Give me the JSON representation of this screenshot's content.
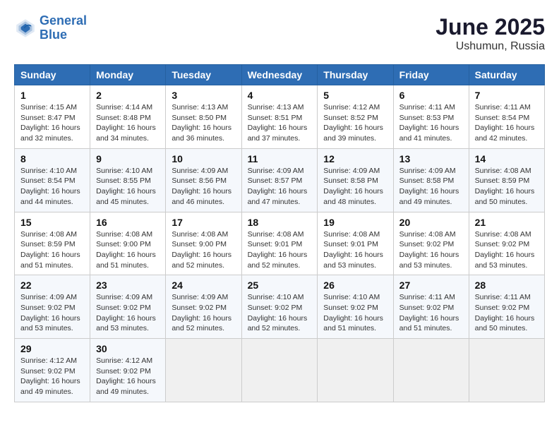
{
  "header": {
    "logo_line1": "General",
    "logo_line2": "Blue",
    "title": "June 2025",
    "subtitle": "Ushumun, Russia"
  },
  "calendar": {
    "headers": [
      "Sunday",
      "Monday",
      "Tuesday",
      "Wednesday",
      "Thursday",
      "Friday",
      "Saturday"
    ],
    "rows": [
      [
        {
          "day": "1",
          "lines": [
            "Sunrise: 4:15 AM",
            "Sunset: 8:47 PM",
            "Daylight: 16 hours",
            "and 32 minutes."
          ]
        },
        {
          "day": "2",
          "lines": [
            "Sunrise: 4:14 AM",
            "Sunset: 8:48 PM",
            "Daylight: 16 hours",
            "and 34 minutes."
          ]
        },
        {
          "day": "3",
          "lines": [
            "Sunrise: 4:13 AM",
            "Sunset: 8:50 PM",
            "Daylight: 16 hours",
            "and 36 minutes."
          ]
        },
        {
          "day": "4",
          "lines": [
            "Sunrise: 4:13 AM",
            "Sunset: 8:51 PM",
            "Daylight: 16 hours",
            "and 37 minutes."
          ]
        },
        {
          "day": "5",
          "lines": [
            "Sunrise: 4:12 AM",
            "Sunset: 8:52 PM",
            "Daylight: 16 hours",
            "and 39 minutes."
          ]
        },
        {
          "day": "6",
          "lines": [
            "Sunrise: 4:11 AM",
            "Sunset: 8:53 PM",
            "Daylight: 16 hours",
            "and 41 minutes."
          ]
        },
        {
          "day": "7",
          "lines": [
            "Sunrise: 4:11 AM",
            "Sunset: 8:54 PM",
            "Daylight: 16 hours",
            "and 42 minutes."
          ]
        }
      ],
      [
        {
          "day": "8",
          "lines": [
            "Sunrise: 4:10 AM",
            "Sunset: 8:54 PM",
            "Daylight: 16 hours",
            "and 44 minutes."
          ]
        },
        {
          "day": "9",
          "lines": [
            "Sunrise: 4:10 AM",
            "Sunset: 8:55 PM",
            "Daylight: 16 hours",
            "and 45 minutes."
          ]
        },
        {
          "day": "10",
          "lines": [
            "Sunrise: 4:09 AM",
            "Sunset: 8:56 PM",
            "Daylight: 16 hours",
            "and 46 minutes."
          ]
        },
        {
          "day": "11",
          "lines": [
            "Sunrise: 4:09 AM",
            "Sunset: 8:57 PM",
            "Daylight: 16 hours",
            "and 47 minutes."
          ]
        },
        {
          "day": "12",
          "lines": [
            "Sunrise: 4:09 AM",
            "Sunset: 8:58 PM",
            "Daylight: 16 hours",
            "and 48 minutes."
          ]
        },
        {
          "day": "13",
          "lines": [
            "Sunrise: 4:09 AM",
            "Sunset: 8:58 PM",
            "Daylight: 16 hours",
            "and 49 minutes."
          ]
        },
        {
          "day": "14",
          "lines": [
            "Sunrise: 4:08 AM",
            "Sunset: 8:59 PM",
            "Daylight: 16 hours",
            "and 50 minutes."
          ]
        }
      ],
      [
        {
          "day": "15",
          "lines": [
            "Sunrise: 4:08 AM",
            "Sunset: 8:59 PM",
            "Daylight: 16 hours",
            "and 51 minutes."
          ]
        },
        {
          "day": "16",
          "lines": [
            "Sunrise: 4:08 AM",
            "Sunset: 9:00 PM",
            "Daylight: 16 hours",
            "and 51 minutes."
          ]
        },
        {
          "day": "17",
          "lines": [
            "Sunrise: 4:08 AM",
            "Sunset: 9:00 PM",
            "Daylight: 16 hours",
            "and 52 minutes."
          ]
        },
        {
          "day": "18",
          "lines": [
            "Sunrise: 4:08 AM",
            "Sunset: 9:01 PM",
            "Daylight: 16 hours",
            "and 52 minutes."
          ]
        },
        {
          "day": "19",
          "lines": [
            "Sunrise: 4:08 AM",
            "Sunset: 9:01 PM",
            "Daylight: 16 hours",
            "and 53 minutes."
          ]
        },
        {
          "day": "20",
          "lines": [
            "Sunrise: 4:08 AM",
            "Sunset: 9:02 PM",
            "Daylight: 16 hours",
            "and 53 minutes."
          ]
        },
        {
          "day": "21",
          "lines": [
            "Sunrise: 4:08 AM",
            "Sunset: 9:02 PM",
            "Daylight: 16 hours",
            "and 53 minutes."
          ]
        }
      ],
      [
        {
          "day": "22",
          "lines": [
            "Sunrise: 4:09 AM",
            "Sunset: 9:02 PM",
            "Daylight: 16 hours",
            "and 53 minutes."
          ]
        },
        {
          "day": "23",
          "lines": [
            "Sunrise: 4:09 AM",
            "Sunset: 9:02 PM",
            "Daylight: 16 hours",
            "and 53 minutes."
          ]
        },
        {
          "day": "24",
          "lines": [
            "Sunrise: 4:09 AM",
            "Sunset: 9:02 PM",
            "Daylight: 16 hours",
            "and 52 minutes."
          ]
        },
        {
          "day": "25",
          "lines": [
            "Sunrise: 4:10 AM",
            "Sunset: 9:02 PM",
            "Daylight: 16 hours",
            "and 52 minutes."
          ]
        },
        {
          "day": "26",
          "lines": [
            "Sunrise: 4:10 AM",
            "Sunset: 9:02 PM",
            "Daylight: 16 hours",
            "and 51 minutes."
          ]
        },
        {
          "day": "27",
          "lines": [
            "Sunrise: 4:11 AM",
            "Sunset: 9:02 PM",
            "Daylight: 16 hours",
            "and 51 minutes."
          ]
        },
        {
          "day": "28",
          "lines": [
            "Sunrise: 4:11 AM",
            "Sunset: 9:02 PM",
            "Daylight: 16 hours",
            "and 50 minutes."
          ]
        }
      ],
      [
        {
          "day": "29",
          "lines": [
            "Sunrise: 4:12 AM",
            "Sunset: 9:02 PM",
            "Daylight: 16 hours",
            "and 49 minutes."
          ]
        },
        {
          "day": "30",
          "lines": [
            "Sunrise: 4:12 AM",
            "Sunset: 9:02 PM",
            "Daylight: 16 hours",
            "and 49 minutes."
          ]
        },
        {
          "day": "",
          "lines": []
        },
        {
          "day": "",
          "lines": []
        },
        {
          "day": "",
          "lines": []
        },
        {
          "day": "",
          "lines": []
        },
        {
          "day": "",
          "lines": []
        }
      ]
    ]
  }
}
